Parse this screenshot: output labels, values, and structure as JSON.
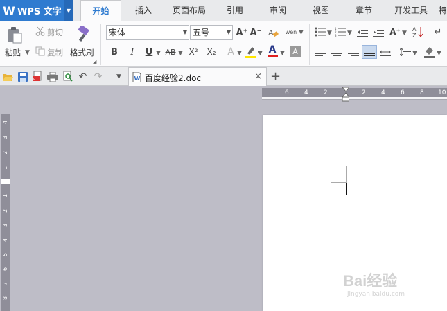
{
  "app": {
    "brand": "WPS 文字",
    "logo_glyph": "W",
    "accent": "#2f7bd0"
  },
  "menu_tabs": [
    {
      "label": "开始",
      "active": true
    },
    {
      "label": "插入"
    },
    {
      "label": "页面布局"
    },
    {
      "label": "引用"
    },
    {
      "label": "审阅"
    },
    {
      "label": "视图"
    },
    {
      "label": "章节"
    },
    {
      "label": "开发工具"
    },
    {
      "label": "特"
    }
  ],
  "ribbon": {
    "paste": "粘贴",
    "cut": "剪切",
    "copy": "复制",
    "format_painter": "格式刷",
    "font_name": "宋体",
    "font_size": "五号",
    "bold": "B",
    "italic": "I",
    "underline": "U",
    "strike": "AB",
    "superscript": "X²",
    "subscript": "X₂",
    "grow_font": "A⁺",
    "shrink_font": "A⁻",
    "phonetic": "wén",
    "font_color": "A",
    "highlight_color": "#ffe600",
    "font_color_bar": "#e02020"
  },
  "document_tab": {
    "name": "百度经验2.doc"
  },
  "ruler": {
    "horizontal_ticks": [
      "6",
      "4",
      "2",
      "2",
      "4",
      "6",
      "8",
      "10"
    ],
    "vertical_ticks": [
      "4",
      "3",
      "2",
      "1",
      "1",
      "2",
      "3",
      "4",
      "5",
      "6",
      "7",
      "8"
    ]
  },
  "watermark": {
    "line1": "Bai经验",
    "line2": "jingyan.baidu.com"
  }
}
